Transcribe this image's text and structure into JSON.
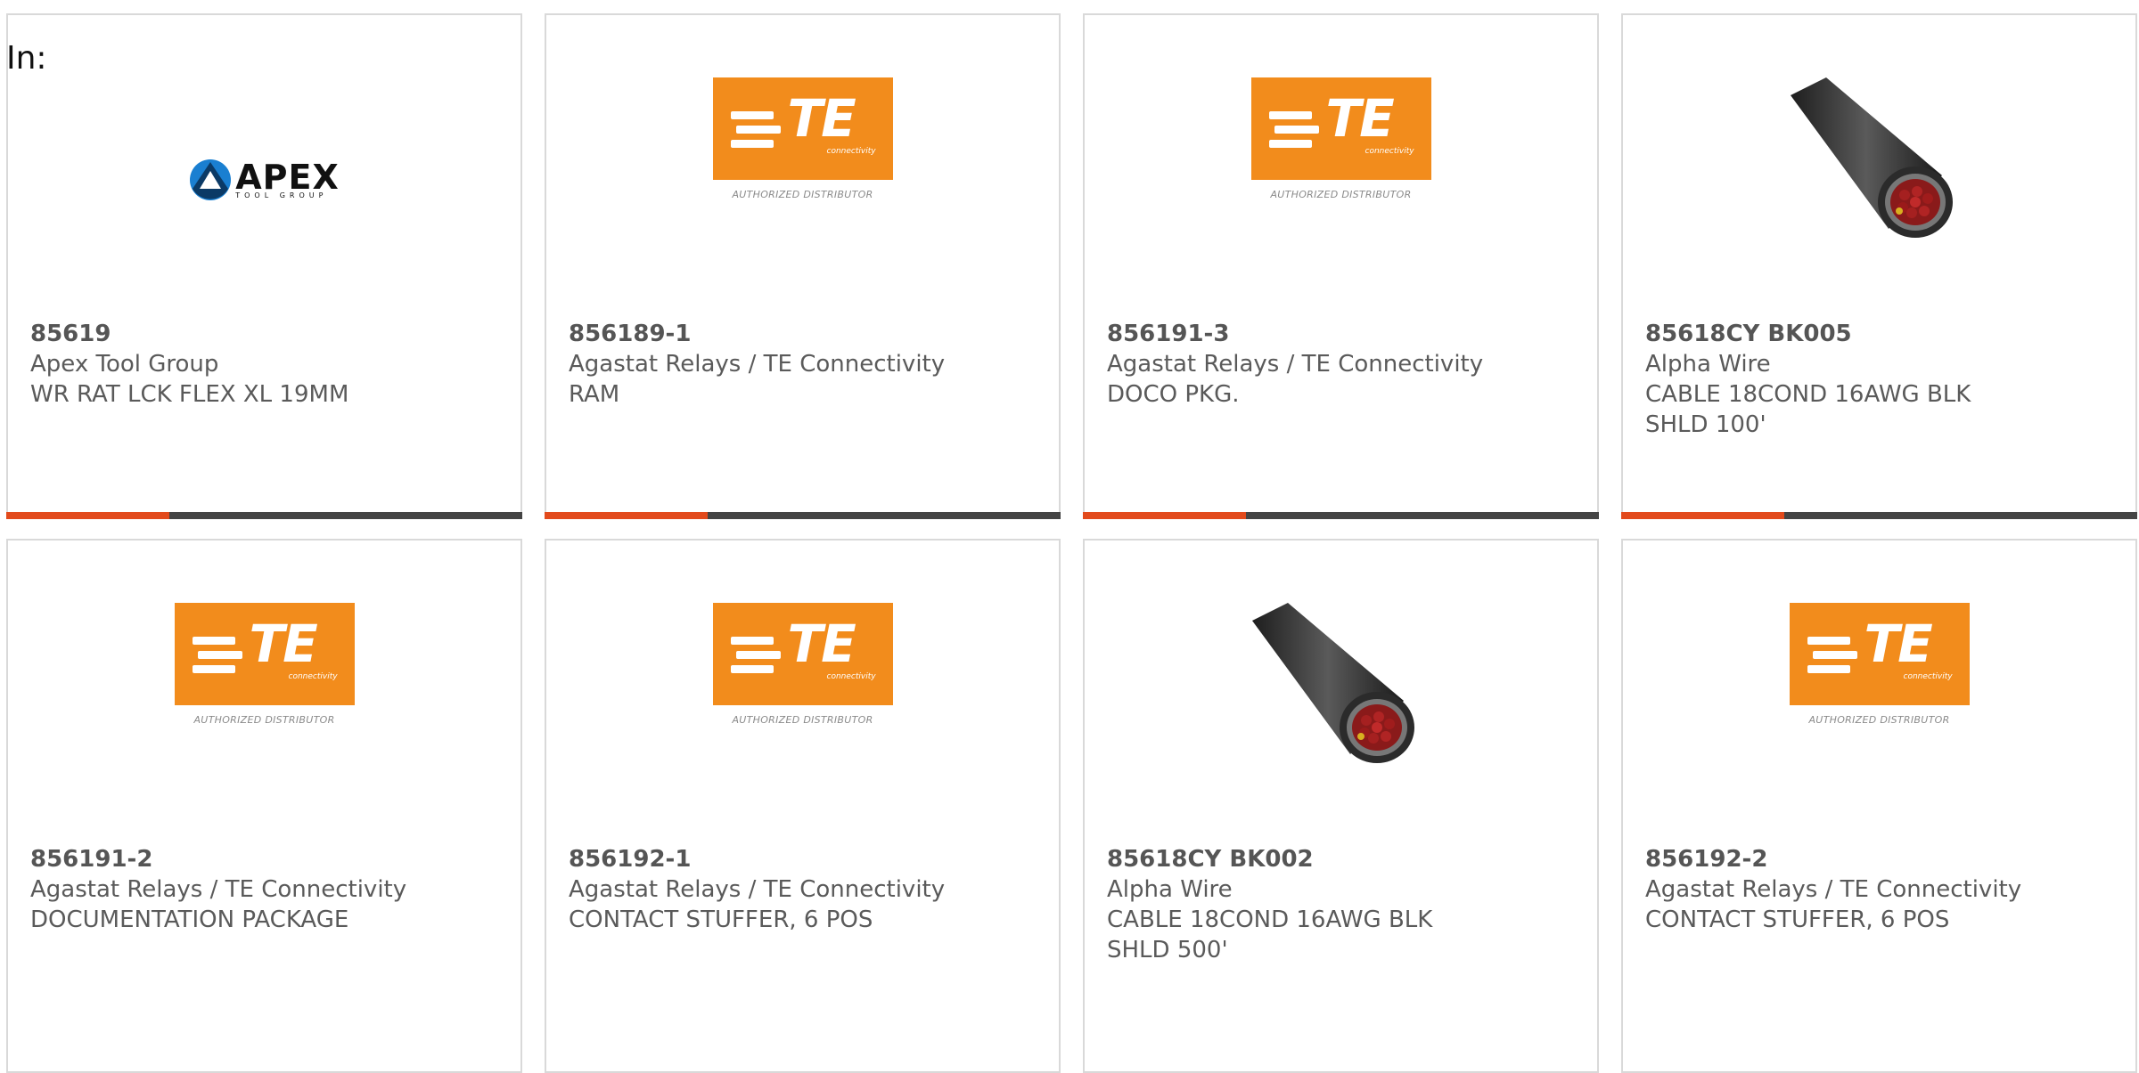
{
  "page": {
    "prefix_label": "In:"
  },
  "colors": {
    "accent": "#e24a1c",
    "bar_dark": "#444444",
    "te_orange": "#f28c1c"
  },
  "products": [
    {
      "part": "85619",
      "manufacturer": "Apex Tool Group",
      "description": "WR RAT LCK FLEX XL 19MM",
      "image": "apex-tool-group-logo",
      "logo_text": "APEX",
      "logo_subtext": "TOOL GROUP"
    },
    {
      "part": "856189-1",
      "manufacturer": "Agastat Relays / TE Connectivity",
      "description": "RAM",
      "image": "te-connectivity-logo",
      "logo_text": "TE",
      "logo_subtext": "connectivity",
      "logo_caption": "AUTHORIZED DISTRIBUTOR"
    },
    {
      "part": "856191-3",
      "manufacturer": "Agastat Relays / TE Connectivity",
      "description": "DOCO PKG.",
      "image": "te-connectivity-logo",
      "logo_text": "TE",
      "logo_subtext": "connectivity",
      "logo_caption": "AUTHORIZED DISTRIBUTOR"
    },
    {
      "part": "85618CY BK005",
      "manufacturer": "Alpha Wire",
      "description": "CABLE 18COND 16AWG BLK SHLD 100'",
      "image": "cable-photo"
    },
    {
      "part": "856191-2",
      "manufacturer": "Agastat Relays / TE Connectivity",
      "description": "DOCUMENTATION PACKAGE",
      "image": "te-connectivity-logo",
      "logo_text": "TE",
      "logo_subtext": "connectivity",
      "logo_caption": "AUTHORIZED DISTRIBUTOR"
    },
    {
      "part": "856192-1",
      "manufacturer": "Agastat Relays / TE Connectivity",
      "description": "CONTACT STUFFER, 6 POS",
      "image": "te-connectivity-logo",
      "logo_text": "TE",
      "logo_subtext": "connectivity",
      "logo_caption": "AUTHORIZED DISTRIBUTOR"
    },
    {
      "part": "85618CY BK002",
      "manufacturer": "Alpha Wire",
      "description": "CABLE 18COND 16AWG BLK SHLD 500'",
      "image": "cable-photo"
    },
    {
      "part": "856192-2",
      "manufacturer": "Agastat Relays / TE Connectivity",
      "description": "CONTACT STUFFER, 6 POS",
      "image": "te-connectivity-logo",
      "logo_text": "TE",
      "logo_subtext": "connectivity",
      "logo_caption": "AUTHORIZED DISTRIBUTOR"
    }
  ]
}
